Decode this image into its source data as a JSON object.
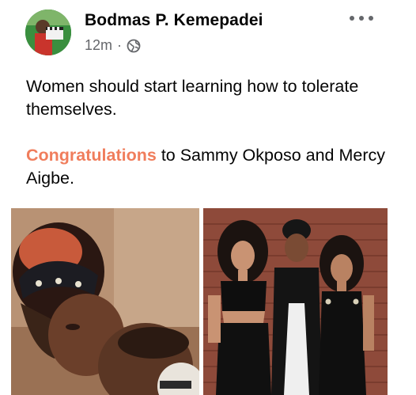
{
  "post": {
    "author": "Bodmas P. Kemepadei",
    "time": "12m",
    "separator": "·",
    "privacy_icon": "globe-icon",
    "more_icon": "more-horizontal-icon",
    "text_line1": "Women should start learning how to tolerate themselves.",
    "highlight": "Congratulations",
    "text_line2_rest": " to Sammy Okposo and Mercy Aigbe."
  },
  "colors": {
    "highlight": "#f07d5c",
    "meta": "#65676b",
    "text": "#050505"
  }
}
